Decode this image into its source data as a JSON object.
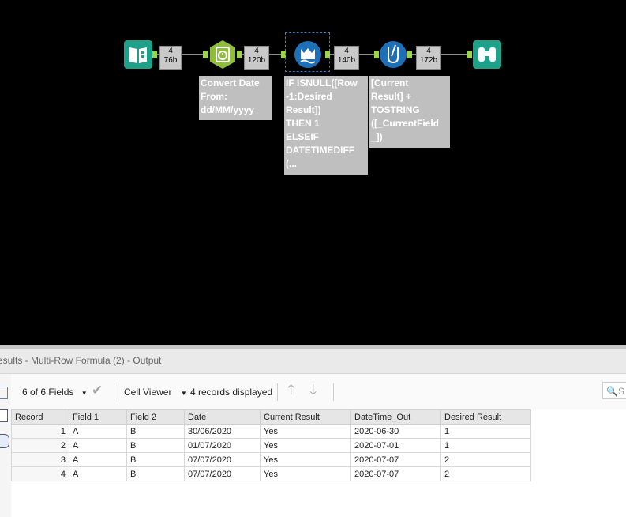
{
  "canvas": {
    "badges": [
      {
        "count": "4",
        "size": "76b"
      },
      {
        "count": "4",
        "size": "120b"
      },
      {
        "count": "4",
        "size": "140b"
      },
      {
        "count": "4",
        "size": "172b"
      }
    ],
    "annotations": {
      "datetime": "Convert Date\nFrom:\ndd/MM/yyyy",
      "multirow": "IF ISNULL([Row\n-1:Desired\nResult])\nTHEN 1\nELSEIF\nDATETIMEDIFF\n(...",
      "formula": "[Current\nResult] +\nTOSTRING\n([_CurrentField\n_])"
    }
  },
  "results": {
    "title": "esults - Multi-Row Formula (2) - Output",
    "fields_label": "6 of 6 Fields",
    "cell_viewer_label": "Cell Viewer",
    "records_label": "4 records displayed",
    "search_placeholder": "S",
    "columns": [
      "Record",
      "Field 1",
      "Field 2",
      "Date",
      "Current Result",
      "DateTime_Out",
      "Desired Result"
    ],
    "rows": [
      [
        "1",
        "A",
        "B",
        "30/06/2020",
        "Yes",
        "2020-06-30",
        "1"
      ],
      [
        "2",
        "A",
        "B",
        "01/07/2020",
        "Yes",
        "2020-07-01",
        "1"
      ],
      [
        "3",
        "A",
        "B",
        "07/07/2020",
        "Yes",
        "2020-07-07",
        "2"
      ],
      [
        "4",
        "A",
        "B",
        "07/07/2020",
        "Yes",
        "2020-07-07",
        "2"
      ]
    ]
  },
  "colors": {
    "input_tool": "#1fa088",
    "datetime_tool": "#8fbf3a",
    "multirow_tool": "#1d6fb8",
    "formula_tool": "#1d6fb8",
    "browse_tool": "#1fa088",
    "anchor": "#9bd444"
  },
  "icons": [
    "book-icon",
    "clock-icon",
    "crown-water-icon",
    "beaker-icon",
    "binoculars-icon",
    "checkmark-icon",
    "arrow-up-icon",
    "arrow-down-icon",
    "search-icon"
  ]
}
